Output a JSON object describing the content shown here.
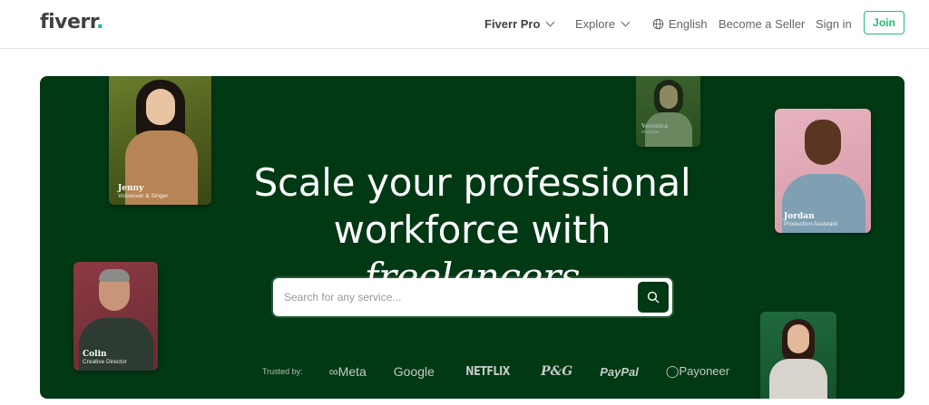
{
  "nav": {
    "logo": "fiverr",
    "logo_dot": ".",
    "items": {
      "pro": "Fiverr Pro",
      "explore": "Explore",
      "language": "English",
      "become_seller": "Become a Seller",
      "sign_in": "Sign in",
      "join": "Join"
    }
  },
  "hero": {
    "headline_line1": "Scale your professional",
    "headline_line2_prefix": "workforce with ",
    "headline_line2_em": "freelancers",
    "search": {
      "placeholder": "Search for any service..."
    },
    "trusted_label": "Trusted by:",
    "brands": [
      "∞Meta",
      "Google",
      "NETFLIX",
      "P&G",
      "PayPal",
      "◯Payoneer"
    ],
    "cards": {
      "jenny": {
        "name": "Jenny",
        "role": "Voiceover & Singer"
      },
      "veronica": {
        "name": "Veronica",
        "role": "Presenter"
      },
      "jordan": {
        "name": "Jordan",
        "role": "Production Assistant"
      },
      "colin": {
        "name": "Colin",
        "role": "Creative Director"
      }
    }
  },
  "colors": {
    "hero_bg": "#013914",
    "brand_green": "#1dbf73",
    "text_dark": "#404145"
  }
}
